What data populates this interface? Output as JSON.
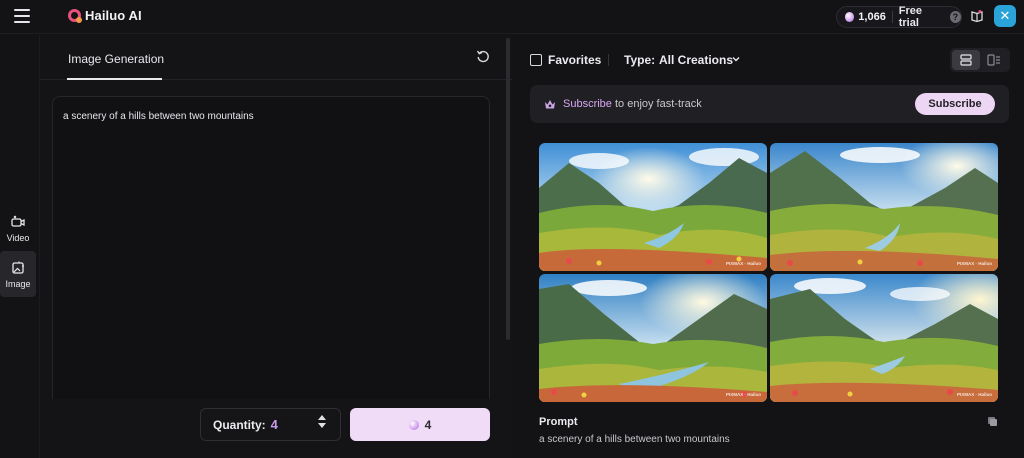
{
  "app": {
    "name": "Hailuo AI"
  },
  "header": {
    "credits": "1,066",
    "free_trial": "Free trial",
    "help": "?",
    "avatar_initial": "✕"
  },
  "sidebar": {
    "items": [
      {
        "label": "Video"
      },
      {
        "label": "Image"
      }
    ]
  },
  "editor": {
    "title": "Image Generation",
    "prompt": "a scenery of a hills between two mountains",
    "quantity_label": "Quantity:",
    "quantity_value": "4",
    "generate_cost": "4"
  },
  "gallery": {
    "favorites_label": "Favorites",
    "type_label": "Type:",
    "type_value": "All Creations",
    "subscribe_highlight": "Subscribe",
    "subscribe_rest": " to enjoy fast-track",
    "subscribe_button": "Subscribe",
    "watermark": "PIXMAX · Hailuo",
    "prompt_heading": "Prompt",
    "prompt_text": "a scenery of a hills between two mountains"
  },
  "colors": {
    "accent": "#c59bea",
    "button_bg": "#f0dcf6",
    "background": "#131316"
  }
}
